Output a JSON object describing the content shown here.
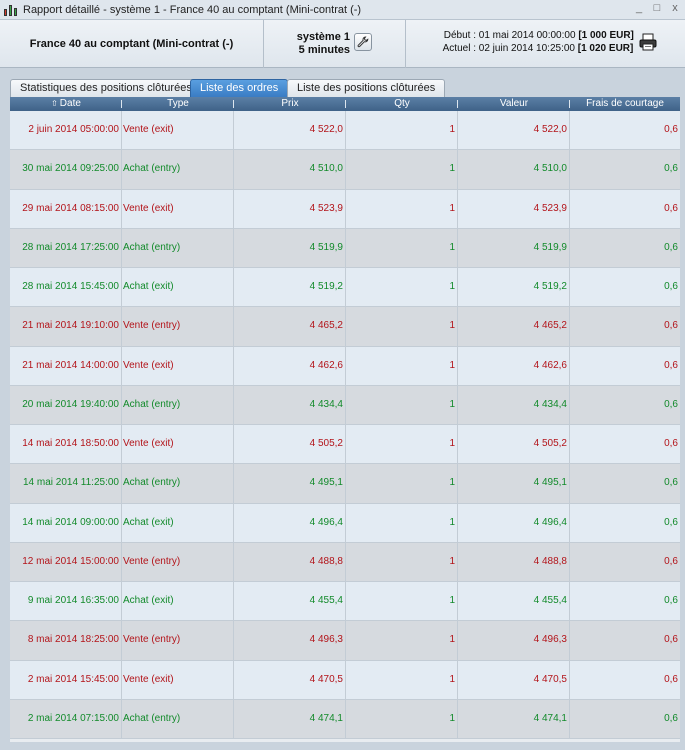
{
  "window": {
    "title": "Rapport détaillé - système 1 - France 40 au comptant (Mini-contrat  (-)",
    "minimize": "_",
    "maximize": "□",
    "close": "x"
  },
  "header": {
    "instrument": "France 40 au comptant (Mini-contrat  (-)",
    "system_name": "système 1",
    "timeframe": "5 minutes",
    "start_label": "Début :",
    "start_date": "01 mai 2014 00:00:00",
    "start_capital": "[1 000 EUR]",
    "current_label": "Actuel :",
    "current_date": "02 juin 2014 10:25:00",
    "current_capital": "[1 020 EUR]"
  },
  "tabs": [
    {
      "label": "Statistiques des positions clôturées",
      "active": false
    },
    {
      "label": "Liste des ordres",
      "active": true
    },
    {
      "label": "Liste des positions clôturées",
      "active": false
    }
  ],
  "table": {
    "columns": [
      "Date",
      "Type",
      "Prix",
      "Qty",
      "Valeur",
      "Frais de courtage"
    ],
    "sort_indicator": "⇧",
    "rows": [
      {
        "date": "2 juin 2014 05:00:00",
        "type": "Vente (exit)",
        "price": "4 522,0",
        "qty": "1",
        "value": "4 522,0",
        "fee": "0,6",
        "color": "red"
      },
      {
        "date": "30 mai 2014 09:25:00",
        "type": "Achat (entry)",
        "price": "4 510,0",
        "qty": "1",
        "value": "4 510,0",
        "fee": "0,6",
        "color": "green"
      },
      {
        "date": "29 mai 2014 08:15:00",
        "type": "Vente (exit)",
        "price": "4 523,9",
        "qty": "1",
        "value": "4 523,9",
        "fee": "0,6",
        "color": "red"
      },
      {
        "date": "28 mai 2014 17:25:00",
        "type": "Achat (entry)",
        "price": "4 519,9",
        "qty": "1",
        "value": "4 519,9",
        "fee": "0,6",
        "color": "green"
      },
      {
        "date": "28 mai 2014 15:45:00",
        "type": "Achat (exit)",
        "price": "4 519,2",
        "qty": "1",
        "value": "4 519,2",
        "fee": "0,6",
        "color": "green"
      },
      {
        "date": "21 mai 2014 19:10:00",
        "type": "Vente (entry)",
        "price": "4 465,2",
        "qty": "1",
        "value": "4 465,2",
        "fee": "0,6",
        "color": "red"
      },
      {
        "date": "21 mai 2014 14:00:00",
        "type": "Vente (exit)",
        "price": "4 462,6",
        "qty": "1",
        "value": "4 462,6",
        "fee": "0,6",
        "color": "red"
      },
      {
        "date": "20 mai 2014 19:40:00",
        "type": "Achat (entry)",
        "price": "4 434,4",
        "qty": "1",
        "value": "4 434,4",
        "fee": "0,6",
        "color": "green"
      },
      {
        "date": "14 mai 2014 18:50:00",
        "type": "Vente (exit)",
        "price": "4 505,2",
        "qty": "1",
        "value": "4 505,2",
        "fee": "0,6",
        "color": "red"
      },
      {
        "date": "14 mai 2014 11:25:00",
        "type": "Achat (entry)",
        "price": "4 495,1",
        "qty": "1",
        "value": "4 495,1",
        "fee": "0,6",
        "color": "green"
      },
      {
        "date": "14 mai 2014 09:00:00",
        "type": "Achat (exit)",
        "price": "4 496,4",
        "qty": "1",
        "value": "4 496,4",
        "fee": "0,6",
        "color": "green"
      },
      {
        "date": "12 mai 2014 15:00:00",
        "type": "Vente (entry)",
        "price": "4 488,8",
        "qty": "1",
        "value": "4 488,8",
        "fee": "0,6",
        "color": "red"
      },
      {
        "date": "9 mai 2014 16:35:00",
        "type": "Achat (exit)",
        "price": "4 455,4",
        "qty": "1",
        "value": "4 455,4",
        "fee": "0,6",
        "color": "green"
      },
      {
        "date": "8 mai 2014 18:25:00",
        "type": "Vente (entry)",
        "price": "4 496,3",
        "qty": "1",
        "value": "4 496,3",
        "fee": "0,6",
        "color": "red"
      },
      {
        "date": "2 mai 2014 15:45:00",
        "type": "Vente (exit)",
        "price": "4 470,5",
        "qty": "1",
        "value": "4 470,5",
        "fee": "0,6",
        "color": "red"
      },
      {
        "date": "2 mai 2014 07:15:00",
        "type": "Achat (entry)",
        "price": "4 474,1",
        "qty": "1",
        "value": "4 474,1",
        "fee": "0,6",
        "color": "green"
      }
    ]
  },
  "colors": {
    "sell": "#b3141a",
    "buy": "#128a2a",
    "active_tab": "#3a7cc4",
    "table_header": "#4a6d93"
  },
  "icons": {
    "app": "candlestick-chart-icon",
    "settings": "wrench-icon",
    "print": "printer-icon",
    "sort": "sort-up-arrow-icon"
  }
}
